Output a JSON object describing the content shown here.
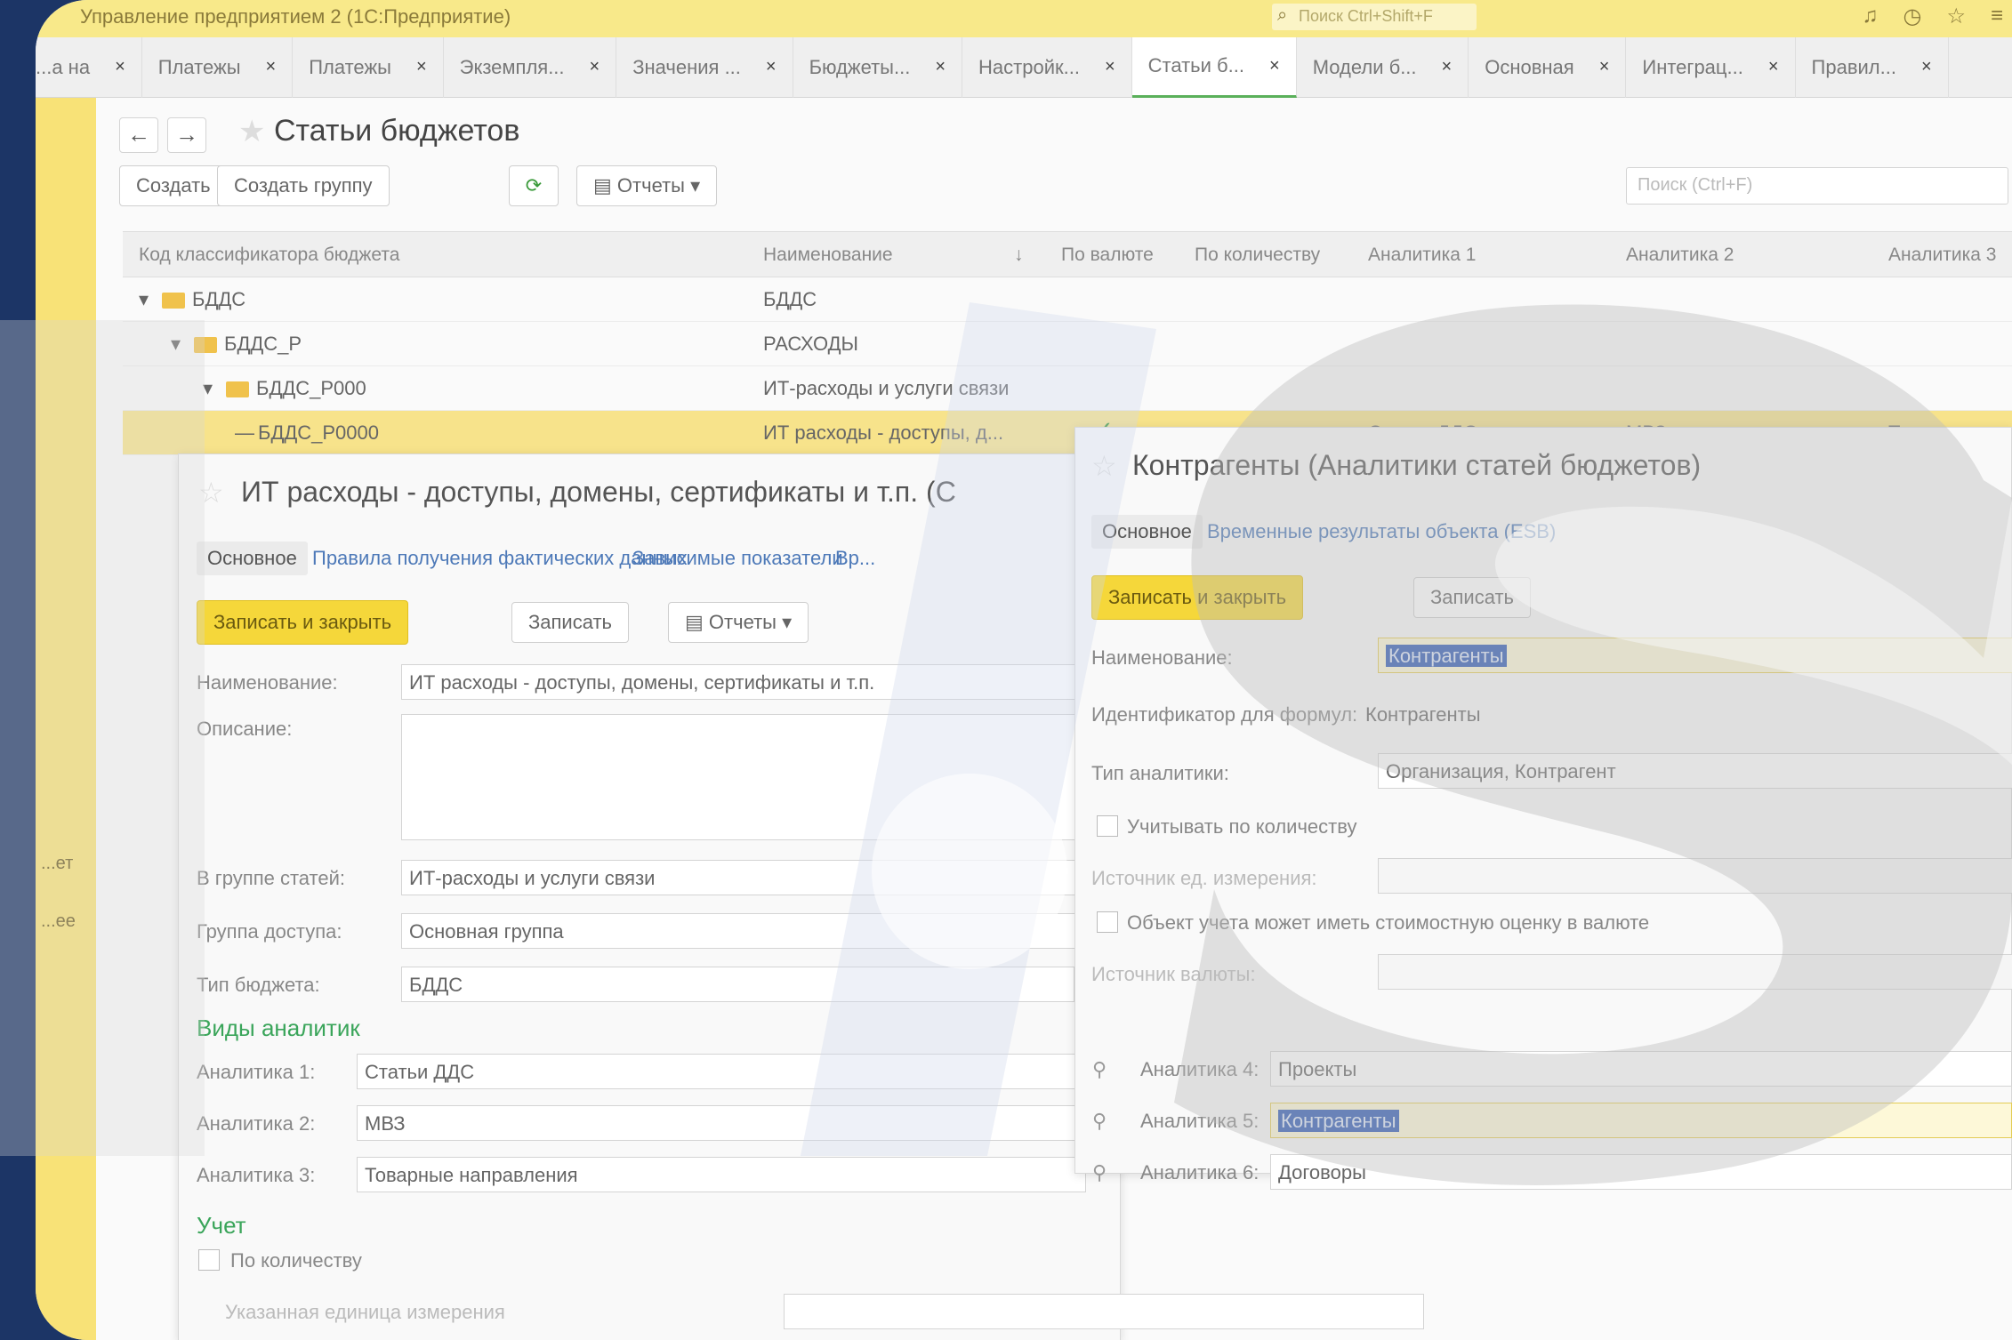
{
  "window": {
    "title": "Управление предприятием 2 (1С:Предприятие)",
    "search_placeholder": "Поиск Ctrl+Shift+F",
    "icons": [
      "bell-icon",
      "history-icon",
      "star-icon",
      "menu-icon"
    ]
  },
  "tabs": [
    {
      "label": "...а на",
      "active": false
    },
    {
      "label": "Платежы",
      "active": false
    },
    {
      "label": "Платежы",
      "active": false
    },
    {
      "label": "Экземпля...",
      "active": false
    },
    {
      "label": "Значения ...",
      "active": false
    },
    {
      "label": "Бюджеты...",
      "active": false
    },
    {
      "label": "Настройк...",
      "active": false
    },
    {
      "label": "Статьи б...",
      "active": true
    },
    {
      "label": "Модели б...",
      "active": false
    },
    {
      "label": "Основная",
      "active": false
    },
    {
      "label": "Интеграц...",
      "active": false
    },
    {
      "label": "Правил...",
      "active": false
    }
  ],
  "sidebar": {
    "labels": [
      "...ет",
      "...ее"
    ]
  },
  "list": {
    "title": "Статьи бюджетов",
    "buttons": {
      "create": "Создать",
      "create_group": "Создать группу",
      "reports": "Отчеты"
    },
    "search_placeholder": "Поиск (Ctrl+F)",
    "columns": [
      "Код классификатора бюджета",
      "Наименование",
      "По валюте",
      "По количеству",
      "Аналитика 1",
      "Аналитика 2",
      "Аналитика 3"
    ],
    "rows": [
      {
        "code": "БДДС",
        "name": "БДДС",
        "level": 0,
        "folder": true
      },
      {
        "code": "БДДС_Р",
        "name": "РАСХОДЫ",
        "level": 1,
        "folder": true
      },
      {
        "code": "БДДС_Р000",
        "name": "ИТ-расходы и услуги связи",
        "level": 2,
        "folder": true
      },
      {
        "code": "БДДС_Р0000",
        "name": "ИТ расходы - доступы, д...",
        "level": 3,
        "folder": false,
        "currency_check": "✓",
        "a1": "Статьи ДДС",
        "a2": "МВЗ",
        "a3": "Товарные напр..."
      }
    ]
  },
  "item_form": {
    "title": "ИТ расходы - доступы, домены, сертификаты и т.п. (С",
    "tabs": [
      "Основное",
      "Правила получения фактических данных",
      "Зависимые показатели",
      "Вр..."
    ],
    "buttons": {
      "save_close": "Записать и закрыть",
      "save": "Записать",
      "reports": "Отчеты"
    },
    "fields": {
      "name_label": "Наименование:",
      "name_value": "ИТ расходы - доступы, домены, сертификаты и т.п.",
      "description_label": "Описание:",
      "group_label": "В группе статей:",
      "group_value": "ИТ-расходы и услуги связи",
      "access_label": "Группа доступа:",
      "access_value": "Основная группа",
      "budget_type_label": "Тип бюджета:",
      "budget_type_value": "БДДС"
    },
    "analytics_section": "Виды аналитик",
    "analytics": [
      {
        "label": "Аналитика 1:",
        "value": "Статьи ДДС"
      },
      {
        "label": "Аналитика 2:",
        "value": "МВЗ"
      },
      {
        "label": "Аналитика 3:",
        "value": "Товарные направления"
      }
    ],
    "analytics_right": [
      {
        "label": "Аналитика 4:",
        "value": "Проекты"
      },
      {
        "label": "Аналитика 5:",
        "value": "Контрагенты"
      },
      {
        "label": "Аналитика 6:",
        "value": "Договоры"
      }
    ],
    "accounting_section": "Учет",
    "by_quantity": "По количеству",
    "unit_label": "Указанная единица измерения"
  },
  "counterparty_form": {
    "title": "Контрагенты (Аналитики статей бюджетов)",
    "tabs": [
      "Основное",
      "Временные результаты объекта (ESB)"
    ],
    "buttons": {
      "save_close": "Записать и закрыть",
      "save": "Записать"
    },
    "fields": {
      "name_label": "Наименование:",
      "name_value": "Контрагенты",
      "formula_id_label": "Идентификатор для формул:",
      "formula_id_value": "Контрагенты",
      "analytics_type_label": "Тип аналитики:",
      "analytics_type_value": "Организация, Контрагент",
      "by_quantity": "Учитывать по количеству",
      "unit_source_label": "Источник ед. измерения:",
      "cost_estimate": "Объект учета может иметь стоимостную оценку в валюте",
      "currency_source_label": "Источник валюты:"
    }
  }
}
